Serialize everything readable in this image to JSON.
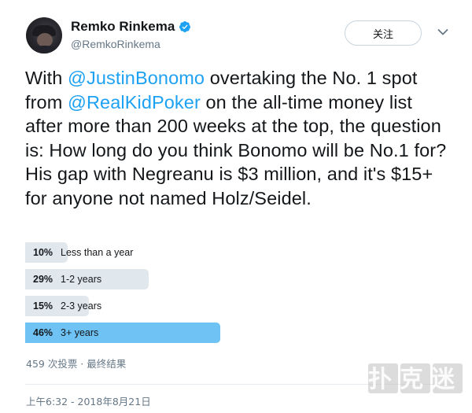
{
  "author": {
    "display_name": "Remko Rinkema",
    "handle": "@RemkoRinkema",
    "verified": true
  },
  "actions": {
    "follow_label": "关注"
  },
  "tweet": {
    "segments": [
      {
        "type": "text",
        "value": "With "
      },
      {
        "type": "mention",
        "value": "@JustinBonomo"
      },
      {
        "type": "text",
        "value": " overtaking the No. 1 spot from "
      },
      {
        "type": "mention",
        "value": "@RealKidPoker"
      },
      {
        "type": "text",
        "value": " on the all-time money list after more than 200 weeks at the top, the question is: How long do you think Bonomo will be No.1 for? His gap with Negreanu is $3 million, and it's $15+ for anyone not named Holz/Seidel."
      }
    ]
  },
  "poll": {
    "options": [
      {
        "percent_label": "10%",
        "label": "Less than a year",
        "percent": 10
      },
      {
        "percent_label": "29%",
        "label": "1-2 years",
        "percent": 29
      },
      {
        "percent_label": "15%",
        "label": "2-3 years",
        "percent": 15
      },
      {
        "percent_label": "46%",
        "label": "3+ years",
        "percent": 46,
        "winner": true
      }
    ],
    "meta": "459 次投票 · 最终结果"
  },
  "timestamp": "上午6:32 - 2018年8月21日",
  "watermark": {
    "text": "扑克迷"
  },
  "colors": {
    "link": "#1da1f2",
    "winner_bar": "#6ec3f4",
    "bar": "#e1e8ed",
    "verified": "#1da1f2",
    "muted": "#657786"
  },
  "icons": {
    "verified": "verified-badge-icon",
    "menu": "chevron-down-icon"
  }
}
